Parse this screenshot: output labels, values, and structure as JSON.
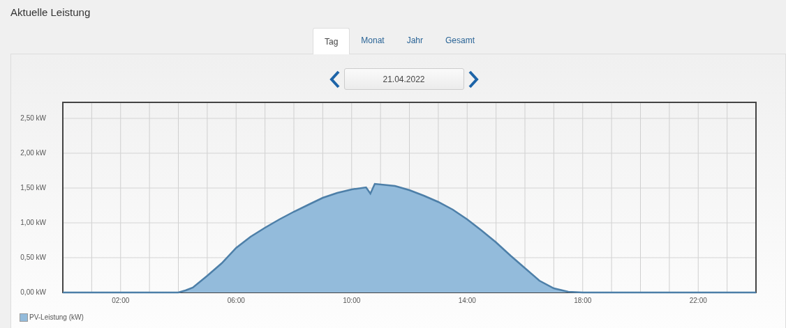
{
  "title": "Aktuelle Leistung",
  "tabs": [
    {
      "label": "Tag",
      "selected": true
    },
    {
      "label": "Monat",
      "selected": false
    },
    {
      "label": "Jahr",
      "selected": false
    },
    {
      "label": "Gesamt",
      "selected": false
    }
  ],
  "date_field": {
    "value": "21.04.2022"
  },
  "chart": {
    "chart_data": {
      "type": "area",
      "grid": true,
      "xlim": [
        0,
        24
      ],
      "ylim": [
        0,
        2.73
      ],
      "xticks": [
        {
          "value": 2,
          "label": "02:00"
        },
        {
          "value": 6,
          "label": "06:00"
        },
        {
          "value": 10,
          "label": "10:00"
        },
        {
          "value": 14,
          "label": "14:00"
        },
        {
          "value": 18,
          "label": "18:00"
        },
        {
          "value": 22,
          "label": "22:00"
        }
      ],
      "yticks": [
        {
          "value": 0,
          "label": "0,00 kW"
        },
        {
          "value": 0.5,
          "label": "0,50 kW"
        },
        {
          "value": 1,
          "label": "1,00 kW"
        },
        {
          "value": 1.5,
          "label": "1,50 kW"
        },
        {
          "value": 2,
          "label": "2,00 kW"
        },
        {
          "value": 2.5,
          "label": "2,50 kW"
        }
      ],
      "x": [
        0,
        4,
        4.25,
        4.5,
        5,
        5.5,
        6,
        6.5,
        7,
        7.5,
        8,
        8.5,
        9,
        9.5,
        10,
        10.5,
        10.65,
        10.8,
        11.5,
        12,
        12.5,
        13,
        13.5,
        14,
        14.5,
        15,
        15.5,
        16,
        16.5,
        17,
        17.5,
        18,
        24
      ],
      "series": [
        {
          "name": "PV-Leistung (kW)",
          "color": "#93bbdb",
          "values": [
            0,
            0,
            0.03,
            0.07,
            0.24,
            0.42,
            0.64,
            0.8,
            0.93,
            1.05,
            1.16,
            1.26,
            1.36,
            1.43,
            1.48,
            1.51,
            1.42,
            1.56,
            1.53,
            1.47,
            1.39,
            1.3,
            1.19,
            1.05,
            0.89,
            0.72,
            0.53,
            0.35,
            0.17,
            0.06,
            0.01,
            0,
            0
          ]
        }
      ]
    }
  }
}
